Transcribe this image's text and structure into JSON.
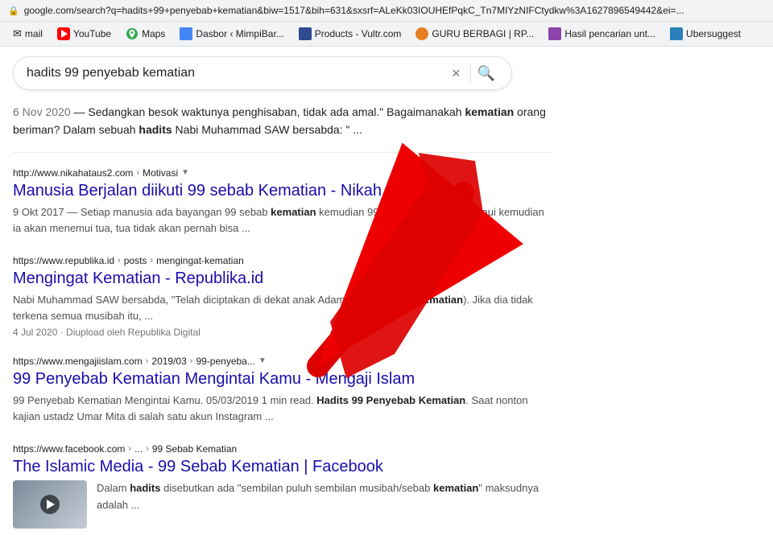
{
  "browser": {
    "url": "google.com/search?q=hadits+99+penyebab+kematian&biw=1517&bih=631&sxsrf=ALeKk03IOUHEfPqkC_Tn7MIYzNIFCtydkw%3A1627896549442&ei=..."
  },
  "bookmarks": {
    "items": [
      {
        "id": "mail",
        "label": "mail",
        "icon": "mail-icon"
      },
      {
        "id": "youtube",
        "label": "YouTube",
        "icon": "yt-icon"
      },
      {
        "id": "maps",
        "label": "Maps",
        "icon": "maps-icon"
      },
      {
        "id": "dasbor",
        "label": "Dasbor ‹ MimpiBar...",
        "icon": "dasbor-icon"
      },
      {
        "id": "products",
        "label": "Products - Vultr.com",
        "icon": "products-icon"
      },
      {
        "id": "guru",
        "label": "GURU BERBAGI | RP...",
        "icon": "guru-icon"
      },
      {
        "id": "hasil",
        "label": "Hasil pencarian unt...",
        "icon": "hasil-icon"
      },
      {
        "id": "ubersuggest",
        "label": "Ubersuggest",
        "icon": "ubersuggest-icon"
      }
    ]
  },
  "search": {
    "query": "hadits 99 penyebab kematian",
    "clear_label": "×",
    "search_icon": "🔍"
  },
  "top_snippet": {
    "date": "6 Nov 2020",
    "text": "— Sedangkan besok waktunya penghisaban, tidak ada amal.\" Bagaimanakah",
    "text2": "orang beriman? Dalam sebuah",
    "bold1": "kematian",
    "text3": "hadits",
    "text4": "Nabi Muhammad SAW bersabda: \" ..."
  },
  "results": [
    {
      "id": "result-1",
      "url": "http://www.nikahataus2.com",
      "breadcrumb": "Motivasi",
      "has_dropdown": true,
      "title": "Manusia Berjalan diikuti 99 sebab Kematian - Nikah Atau S2",
      "snippet": "9 Okt 2017 — Setiap manusia ada bayangan 99 sebab",
      "bold1": "kematian",
      "snippet2": "kemudian 99 sebab mampu dilampaui kemudian ia akan menemui tua, tua tidak akan pernah bisa ..."
    },
    {
      "id": "result-2",
      "url": "https://www.republika.id",
      "breadcrumb": "posts",
      "breadcrumb2": "mengingat-kematian",
      "has_dropdown": false,
      "title": "Mengingat Kematian - Republika.id",
      "snippet": "Nabi Muhammad SAW bersabda, \"Telah diciptakan di dekat anak Adam",
      "bold1": "isibah (sebab",
      "bold2": "kematian",
      "snippet2": "). Jika dia tidak terkena semua musibah itu, ...",
      "meta": "4 Jul 2020 · Diupload oleh Republika Digital"
    },
    {
      "id": "result-3",
      "url": "https://www.mengajiislam.com",
      "breadcrumb": "2019/03",
      "breadcrumb2": "99-penyeba...",
      "has_dropdown": true,
      "title": "99 Penyebab Kematian Mengintai Kamu - Mengaji Islam",
      "snippet": "99 Penyebab Kematian Mengintai Kamu. 05/03/2019 1 min read.",
      "bold1": "Hadits 99 Penyebab",
      "bold2": "Kematian",
      "snippet2": ". Saat nonton kajian ustadz Umar Mita di salah satu akun Instagram ..."
    },
    {
      "id": "result-4",
      "url": "https://www.facebook.com",
      "breadcrumb": "...",
      "breadcrumb2": "99 Sebab Kematian",
      "has_dropdown": false,
      "title": "The Islamic Media - 99 Sebab Kematian | Facebook",
      "snippet": "Dalam",
      "bold1": "hadits",
      "snippet2": "disebutkan ada \"sembilan puluh sembilan musibah/sebab",
      "bold2": "kematian",
      "snippet3": "\" maksudnya adalah ...",
      "has_thumbnail": true
    }
  ],
  "colors": {
    "link_blue": "#1a0dab",
    "visited_purple": "#609",
    "url_green": "#202124",
    "snippet_gray": "#4d5156",
    "meta_gray": "#70757a"
  }
}
